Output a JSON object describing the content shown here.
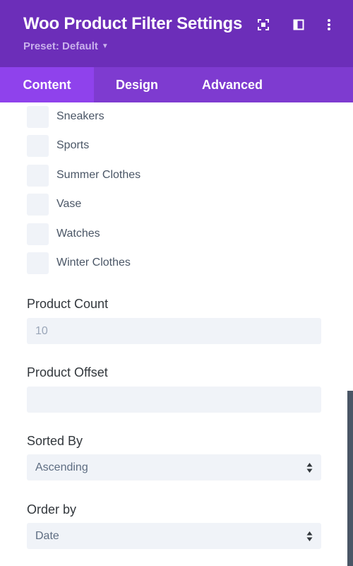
{
  "header": {
    "title": "Woo Product Filter Settings",
    "preset": "Preset: Default",
    "icons": [
      "focus-icon",
      "sidebar-layout-icon",
      "more-vertical-icon"
    ],
    "bg_color": "#6c2eb9"
  },
  "tabs": [
    {
      "label": "Content",
      "active": true
    },
    {
      "label": "Design",
      "active": false
    },
    {
      "label": "Advanced",
      "active": false
    }
  ],
  "categories": [
    {
      "label": "Sneakers",
      "checked": false
    },
    {
      "label": "Sports",
      "checked": false
    },
    {
      "label": "Summer Clothes",
      "checked": false
    },
    {
      "label": "Vase",
      "checked": false
    },
    {
      "label": "Watches",
      "checked": false
    },
    {
      "label": "Winter Clothes",
      "checked": false
    }
  ],
  "fields": {
    "product_count": {
      "label": "Product Count",
      "value": "10"
    },
    "product_offset": {
      "label": "Product Offset",
      "value": ""
    },
    "sorted_by": {
      "label": "Sorted By",
      "value": "Ascending"
    },
    "order_by": {
      "label": "Order by",
      "value": "Date"
    }
  }
}
